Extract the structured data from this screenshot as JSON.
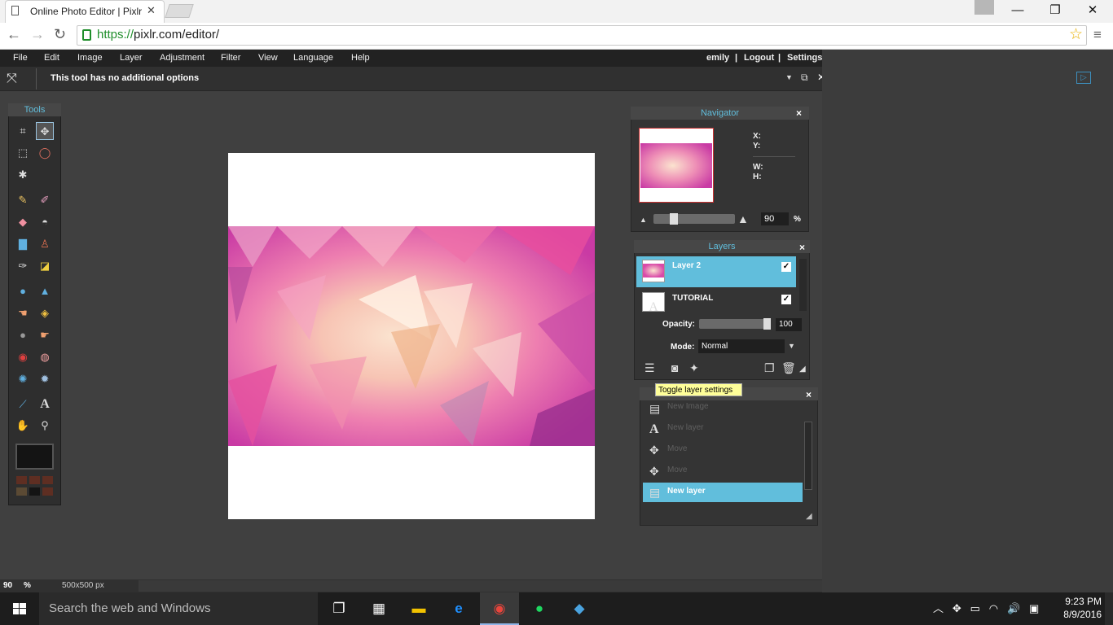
{
  "browser": {
    "tab_title": "Online Photo Editor | Pixlr",
    "tab_close": "✕",
    "url_scheme": "https://",
    "url_rest": "pixlr.com/editor/",
    "win_min": "—",
    "win_restore": "❐",
    "win_close": "✕"
  },
  "menu": {
    "items": [
      "File",
      "Edit",
      "Image",
      "Layer",
      "Adjustment",
      "Filter",
      "View",
      "Language",
      "Help"
    ],
    "user": "emily",
    "sep": "|",
    "logout": "Logout",
    "settings": "Settings"
  },
  "options_bar": {
    "text": "This tool has no additional options"
  },
  "tools": {
    "title": "Tools",
    "icons": [
      "crop-icon",
      "move-icon",
      "marquee-icon",
      "lasso-icon",
      "wand-icon",
      "pencil-icon",
      "brush-icon",
      "eraser-icon",
      "bucket-icon",
      "gradient-icon",
      "stamp-icon",
      "color-replace-icon",
      "drawing-icon",
      "blur-icon",
      "sharpen-icon",
      "smudge-icon",
      "sponge-icon",
      "dodge-icon",
      "burn-icon",
      "red-eye-icon",
      "spot-heal-icon",
      "bloat-icon",
      "pinch-icon",
      "picker-icon",
      "text-icon",
      "hand-icon",
      "zoom-icon"
    ],
    "text_tool_glyph": "A",
    "swatches": [
      "#5e2e22",
      "#5e2e22",
      "#5e2e22",
      "#5b4a34",
      "#141414",
      "#5e2e22"
    ]
  },
  "navigator": {
    "title": "Navigator",
    "close": "×",
    "x_label": "X:",
    "y_label": "Y:",
    "w_label": "W:",
    "h_label": "H:",
    "zoom": "90",
    "zoom_unit": "%"
  },
  "layers": {
    "title": "Layers",
    "close": "×",
    "rows": [
      {
        "name": "Layer 2",
        "check": "✓"
      },
      {
        "name": "TUTORIAL",
        "check": "✓",
        "thumb_glyph": "A"
      }
    ],
    "opacity_label": "Opacity:",
    "opacity_value": "100",
    "mode_label": "Mode:",
    "mode_value": "Normal",
    "tooltip": "Toggle layer settings"
  },
  "history": {
    "close": "×",
    "items": [
      "New Image",
      "New layer",
      "Move",
      "Move",
      "New layer"
    ]
  },
  "status": {
    "zoom": "90",
    "zoom_unit": "%",
    "image_size": "500x500 px"
  },
  "taskbar": {
    "search_placeholder": "Search the web and Windows",
    "time": "9:23 PM",
    "date": "8/9/2016"
  },
  "colors": {
    "accent": "#61bedc",
    "panel": "#343434",
    "workspace": "#404040",
    "tooltip": "#ffff99"
  }
}
